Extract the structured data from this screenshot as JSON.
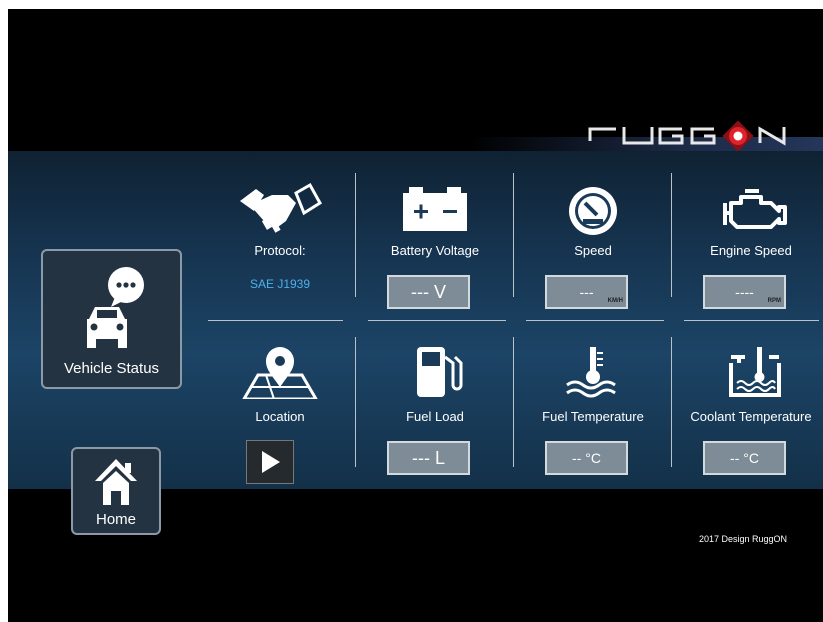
{
  "brand": {
    "logo_text": "RUGGON"
  },
  "sidebar": {
    "vehicle_status_label": "Vehicle Status",
    "home_label": "Home"
  },
  "tiles": {
    "protocol": {
      "caption": "Protocol:",
      "value": "SAE J1939"
    },
    "battery_voltage": {
      "caption": "Battery Voltage",
      "value": "--- V"
    },
    "speed": {
      "caption": "Speed",
      "value": "---",
      "unit": "KM/H"
    },
    "engine_speed": {
      "caption": "Engine Speed",
      "value": "----",
      "unit": "RPM"
    },
    "location": {
      "caption": "Location"
    },
    "fuel_load": {
      "caption": "Fuel Load",
      "value": "--- L"
    },
    "fuel_temperature": {
      "caption": "Fuel Temperature",
      "value": "-- °C"
    },
    "coolant_temperature": {
      "caption": "Coolant Temperature",
      "value": "-- °C"
    }
  },
  "footer": {
    "text": "2017 Design RuggON"
  },
  "colors": {
    "panel": "#1c4466",
    "accent": "#4fb0ea",
    "logo_red": "#e0222b",
    "value_box": "#7d8c96"
  }
}
